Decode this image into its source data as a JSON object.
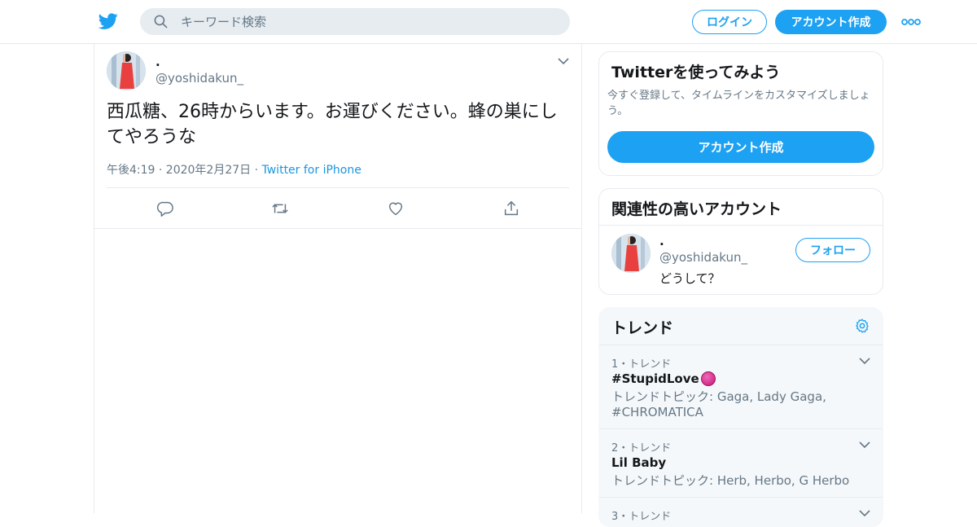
{
  "header": {
    "search_placeholder": "キーワード検索",
    "login_label": "ログイン",
    "signup_label": "アカウント作成"
  },
  "tweet": {
    "display_name": ".",
    "handle": "@yoshidakun_",
    "text": "西瓜糖、26時からいます。お運びください。蜂の巣にしてやろうな",
    "timestamp": "午後4:19 · 2020年2月27日",
    "separator": " · ",
    "source": "Twitter for iPhone"
  },
  "sidebar": {
    "signup_card": {
      "title": "Twitterを使ってみよう",
      "description": "今すぐ登録して、タイムラインをカスタマイズしましょう。",
      "button_label": "アカウント作成"
    },
    "related": {
      "title": "関連性の高いアカウント",
      "display_name": ".",
      "handle": "@yoshidakun_",
      "bio": "どうして？",
      "follow_label": "フォロー"
    },
    "trends": {
      "title": "トレンド",
      "items": [
        {
          "rank": "1・トレンド",
          "name": "#StupidLove",
          "topic": "トレンドトピック: Gaga, Lady Gaga, #CHROMATICA"
        },
        {
          "rank": "2・トレンド",
          "name": "Lil Baby",
          "topic": "トレンドトピック: Herb, Herbo, G Herbo"
        },
        {
          "rank": "3・トレンド",
          "name": "",
          "topic": ""
        }
      ]
    }
  },
  "colors": {
    "accent": "#1da1f2",
    "link": "#1b95e0",
    "secondary_text": "#657786",
    "border": "#e6ecf0",
    "trends_bg": "#f5f8fa"
  },
  "icons": [
    "twitter-bird-icon",
    "search-icon",
    "more-icon",
    "chevron-down-icon",
    "reply-icon",
    "retweet-icon",
    "like-icon",
    "share-icon",
    "settings-gear-icon"
  ]
}
